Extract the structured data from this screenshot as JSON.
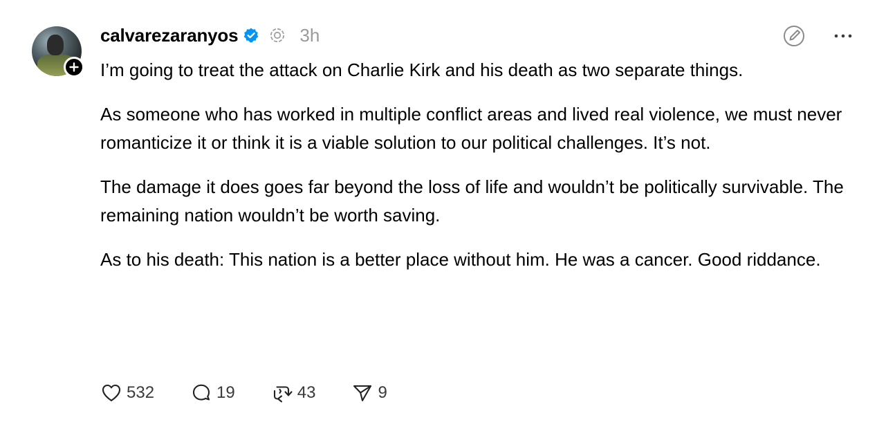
{
  "author": {
    "username": "calvarezaranyos",
    "timestamp": "3h",
    "verified": true,
    "verified_color": "#0095f6"
  },
  "post": {
    "paragraphs": [
      "I’m going to treat the attack on Charlie Kirk and his death as two separate things.",
      "As someone who has worked in multiple conflict areas and lived real violence, we must never romanticize it or think it is a viable solution to our political challenges. It’s not.",
      "The damage it does goes far beyond the loss of life and wouldn’t be politically survivable. The remaining nation wouldn’t be worth saving.",
      "As to his death: This nation is a better place without him. He was a cancer. Good riddance."
    ]
  },
  "actions": {
    "likes": "532",
    "replies": "19",
    "reposts": "43",
    "shares": "9"
  },
  "icons": {
    "like": "heart-icon",
    "reply": "speech-bubble-icon",
    "repost": "repost-arrows-icon",
    "share": "send-icon",
    "edit": "edit-pencil-icon",
    "more": "more-dots-icon",
    "thread": "threads-topic-icon",
    "follow": "plus-icon"
  }
}
